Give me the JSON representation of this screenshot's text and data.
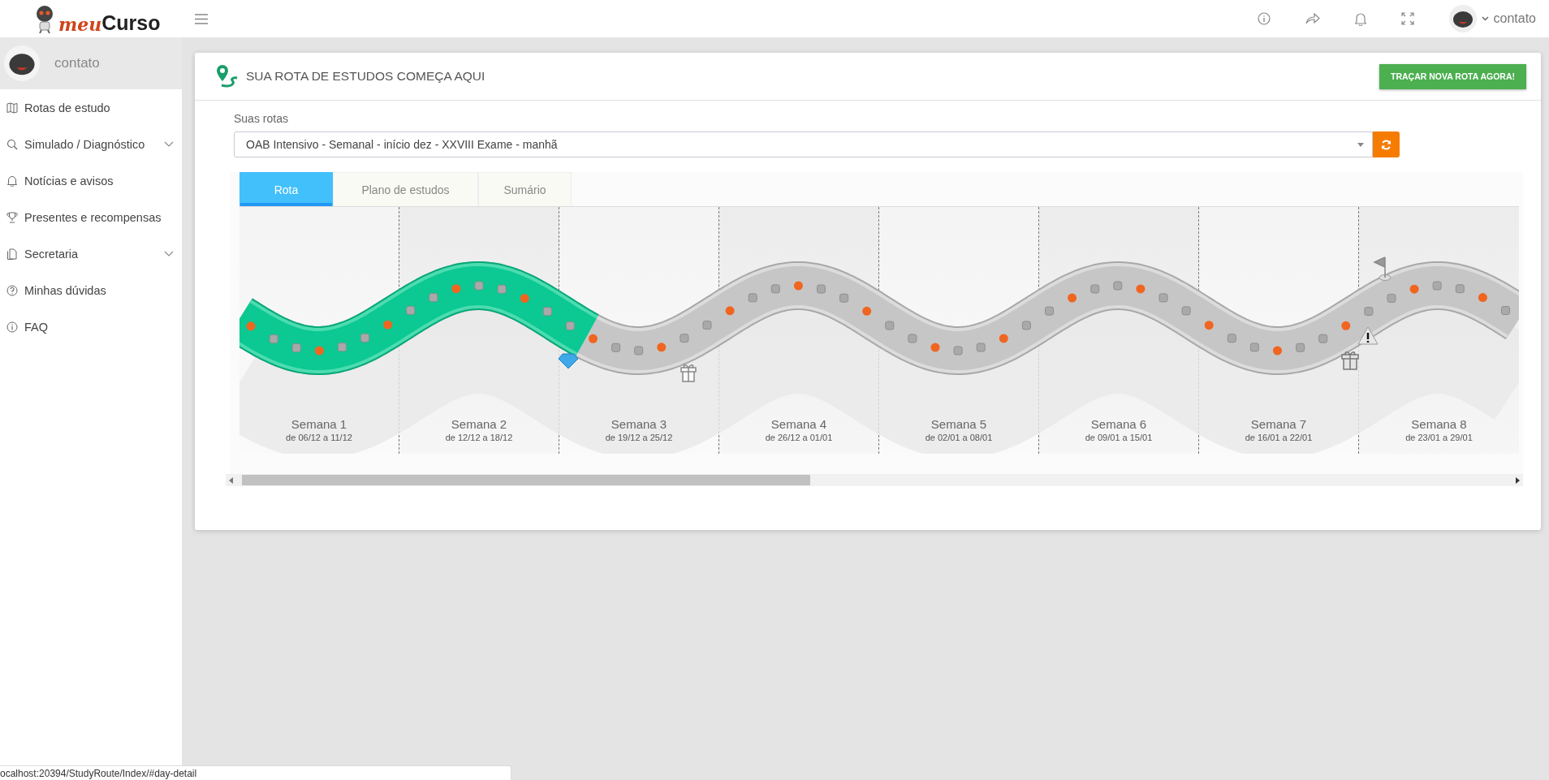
{
  "header": {
    "logo_script": "meu",
    "logo_bold": "Curso",
    "user": "contato"
  },
  "sidebar": {
    "profile_name": "contato",
    "items": [
      {
        "label": "Rotas de estudo",
        "has_submenu": false
      },
      {
        "label": "Simulado / Diagnóstico",
        "has_submenu": true
      },
      {
        "label": "Notícias e avisos",
        "has_submenu": false
      },
      {
        "label": "Presentes e recompensas",
        "has_submenu": false
      },
      {
        "label": "Secretaria",
        "has_submenu": true
      },
      {
        "label": "Minhas dúvidas",
        "has_submenu": false
      },
      {
        "label": "FAQ",
        "has_submenu": false
      }
    ]
  },
  "card": {
    "title": "SUA ROTA DE ESTUDOS COMEÇA AQUI",
    "button": "TRAÇAR NOVA ROTA AGORA!",
    "select_label": "Suas rotas",
    "select_value": "OAB Intensivo - Semanal - início dez - XXVIII Exame - manhã",
    "tabs": [
      {
        "label": "Rota",
        "selected": true
      },
      {
        "label": "Plano de estudos",
        "selected": false
      },
      {
        "label": "Sumário",
        "selected": false
      }
    ],
    "route": {
      "level": 0.273,
      "weeks": [
        {
          "label": "Semana 1",
          "dates": "de 06/12 a 11/12"
        },
        {
          "label": "Semana 2",
          "dates": "de 12/12 a 18/12"
        },
        {
          "label": "Semana 3",
          "dates": "de 19/12 a 25/12"
        },
        {
          "label": "Semana 4",
          "dates": "de 26/12 a 01/01"
        },
        {
          "label": "Semana 5",
          "dates": "de 02/01 a 08/01"
        },
        {
          "label": "Semana 6",
          "dates": "de 09/01 a 15/01"
        },
        {
          "label": "Semana 7",
          "dates": "de 16/01 a 22/01"
        },
        {
          "label": "Semana 8",
          "dates": "de 23/01 a 29/01"
        }
      ]
    }
  },
  "status_bar": "ocalhost:20394/StudyRoute/Index/#day-detail"
}
